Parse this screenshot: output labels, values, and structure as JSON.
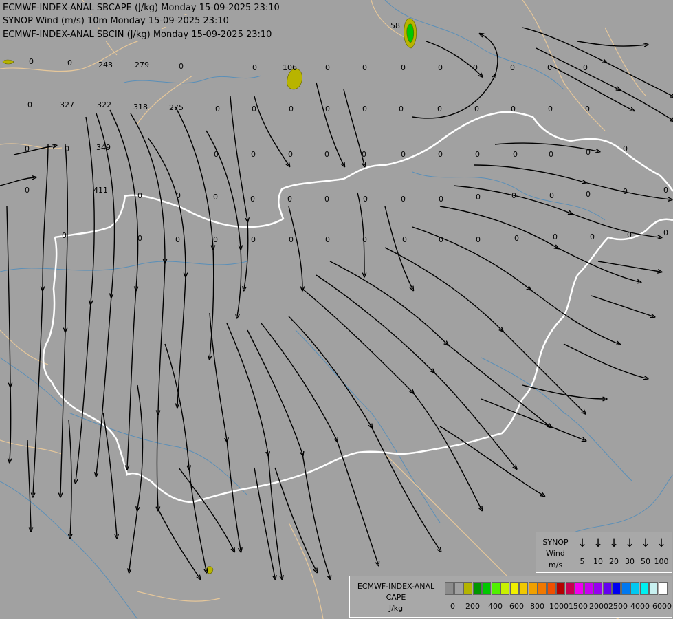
{
  "titles": {
    "line1": "ECMWF-INDEX-ANAL SBCAPE (J/kg) Monday 15-09-2025 23:10",
    "line2": "SYNOP Wind (m/s) 10m Monday 15-09-2025 23:10",
    "line3": "ECMWF-INDEX-ANAL SBCIN (J/kg) Monday 15-09-2025 23:10"
  },
  "colors": {
    "background": "#a1a1a1",
    "streamline": "#000000",
    "country_border": "#ffffff",
    "region_border": "#e6c79a",
    "river": "#5a8fb8",
    "cape_low": "#b8b400",
    "cape_mid": "#00c800"
  },
  "cin_values": [
    {
      "t": "243"
    },
    {
      "t": "279"
    },
    {
      "t": "327"
    },
    {
      "t": "322"
    },
    {
      "t": "318"
    },
    {
      "t": "275"
    },
    {
      "t": "349"
    },
    {
      "t": "411"
    },
    {
      "t": "106"
    },
    {
      "t": "58"
    },
    {
      "t": "0"
    },
    {
      "t": "0"
    },
    {
      "t": "0"
    },
    {
      "t": "0"
    },
    {
      "t": "0"
    },
    {
      "t": "0"
    },
    {
      "t": "0"
    },
    {
      "t": "0"
    },
    {
      "t": "0"
    },
    {
      "t": "0"
    },
    {
      "t": "0"
    },
    {
      "t": "0"
    },
    {
      "t": "0"
    },
    {
      "t": "0"
    },
    {
      "t": "0"
    },
    {
      "t": "0"
    },
    {
      "t": "0"
    },
    {
      "t": "0"
    },
    {
      "t": "0"
    },
    {
      "t": "0"
    },
    {
      "t": "0"
    },
    {
      "t": "0"
    },
    {
      "t": "0"
    },
    {
      "t": "0"
    },
    {
      "t": "0"
    },
    {
      "t": "0"
    },
    {
      "t": "0"
    },
    {
      "t": "0"
    },
    {
      "t": "0"
    },
    {
      "t": "0"
    },
    {
      "t": "0"
    },
    {
      "t": "0"
    },
    {
      "t": "0"
    },
    {
      "t": "0"
    },
    {
      "t": "0"
    },
    {
      "t": "0"
    },
    {
      "t": "0"
    },
    {
      "t": "0"
    },
    {
      "t": "0"
    },
    {
      "t": "0"
    },
    {
      "t": "0"
    },
    {
      "t": "0"
    },
    {
      "t": "0"
    },
    {
      "t": "0"
    },
    {
      "t": "0"
    },
    {
      "t": "0"
    },
    {
      "t": "0"
    },
    {
      "t": "0"
    },
    {
      "t": "0"
    },
    {
      "t": "0"
    },
    {
      "t": "0"
    },
    {
      "t": "0"
    },
    {
      "t": "0"
    },
    {
      "t": "0"
    },
    {
      "t": "0"
    },
    {
      "t": "0"
    },
    {
      "t": "0"
    },
    {
      "t": "0"
    },
    {
      "t": "0"
    },
    {
      "t": "0"
    },
    {
      "t": "0"
    },
    {
      "t": "0"
    },
    {
      "t": "0"
    },
    {
      "t": "0"
    },
    {
      "t": "0"
    },
    {
      "t": "0"
    },
    {
      "t": "0"
    },
    {
      "t": "0"
    },
    {
      "t": "0"
    },
    {
      "t": "0"
    }
  ],
  "wind_legend": {
    "label1": "SYNOP",
    "label2": "Wind",
    "unit": "m/s",
    "speeds": [
      "5",
      "10",
      "20",
      "30",
      "50",
      "100"
    ]
  },
  "cape_legend": {
    "title1": "ECMWF-INDEX-ANAL",
    "title2": "CAPE",
    "unit": "J/kg",
    "colors": [
      "#8c8c8c",
      "#a0a0a0",
      "#b4b400",
      "#009600",
      "#00c800",
      "#50f000",
      "#c8f000",
      "#f0f000",
      "#f0c800",
      "#f0a000",
      "#f07800",
      "#f05000",
      "#b40000",
      "#c80050",
      "#f000f0",
      "#c800f0",
      "#9600f0",
      "#6400f0",
      "#0000f0",
      "#0078f0",
      "#00c8f0",
      "#00f0f0",
      "#c8f0f0",
      "#ffffff"
    ],
    "labels": [
      "0",
      "200",
      "400",
      "600",
      "800",
      "1000",
      "1500",
      "2000",
      "2500",
      "4000",
      "6000"
    ]
  }
}
